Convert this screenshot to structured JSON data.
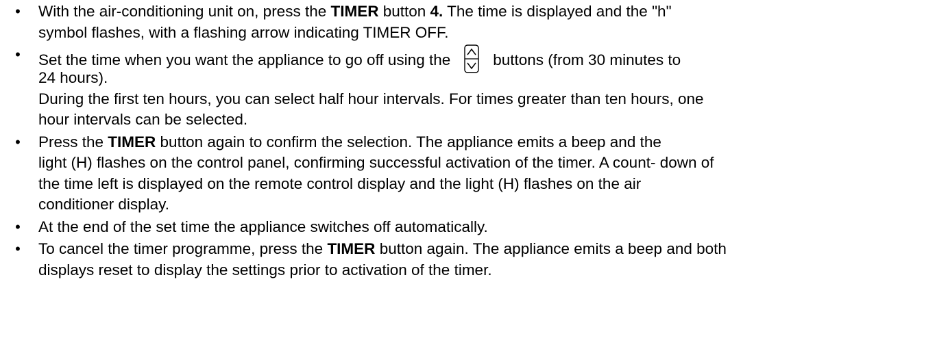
{
  "items": [
    {
      "l1_a": "With the air-conditioning unit on, press the ",
      "l1_b": "TIMER",
      "l1_c": " button ",
      "l1_d": "4.",
      "l1_e": " The time is displayed and the \"h\"",
      "l2": "symbol flashes, with a flashing arrow indicating TIMER OFF."
    },
    {
      "l1_a": "Set the time when you want the appliance to go off using the",
      "l1_b": "buttons (from 30 minutes to",
      "l2": "24 hours).",
      "l3": "During the first ten hours, you  can select half hour intervals. For times greater than ten hours, one",
      "l4": "hour intervals can be selected."
    },
    {
      "l1_a": "Press the ",
      "l1_b": "TIMER",
      "l1_c": " button again to confirm the selection. The appliance emits a beep and the",
      "l2": "light (H) flashes on the control panel, confirming successful activation of the timer. A count- down of",
      "l3": "the time left is displayed on the remote control display and the light (H) flashes on the air",
      "l4": "conditioner display."
    },
    {
      "l1": "At the end of the set time the appliance switches off automatically."
    },
    {
      "l1_a": "To cancel the timer programme, press the ",
      "l1_b": "TIMER",
      "l1_c": " button again. The appliance emits a beep and both",
      "l2": "displays reset to display the settings prior to activation of the timer."
    }
  ],
  "icons": {
    "up_down": "up-down-arrow-buttons-icon"
  },
  "colors": {
    "text": "#000000",
    "background": "#ffffff"
  }
}
